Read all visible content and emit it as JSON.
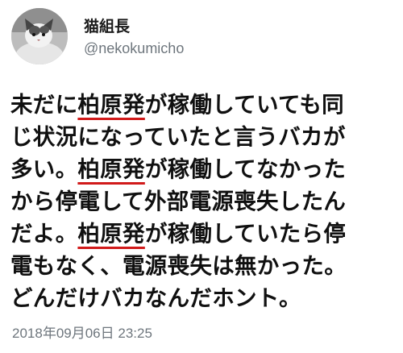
{
  "author": {
    "display_name": "猫組長",
    "handle": "@nekokumicho",
    "avatar_icon": "cat-avatar-icon"
  },
  "tweet": {
    "lines": [
      {
        "before": "未だに",
        "highlight": "柏原発",
        "after": "が稼働していても同"
      },
      {
        "before": "じ状況になっていたと言うバカが",
        "highlight": "",
        "after": ""
      },
      {
        "before": "多い。",
        "highlight": "柏原発",
        "after": "が稼働してなかった"
      },
      {
        "before": "から停電して外部電源喪失したん",
        "highlight": "",
        "after": ""
      },
      {
        "before": "だよ。",
        "highlight": "柏原発",
        "after": "が稼働していたら停"
      },
      {
        "before": "電もなく、電源喪失は無かった。",
        "highlight": "",
        "after": ""
      },
      {
        "before": "どんだけバカなんだホント。",
        "highlight": "",
        "after": ""
      }
    ],
    "highlight_color": "#d11a1a",
    "timestamp": "2018年09月06日 23:25"
  }
}
